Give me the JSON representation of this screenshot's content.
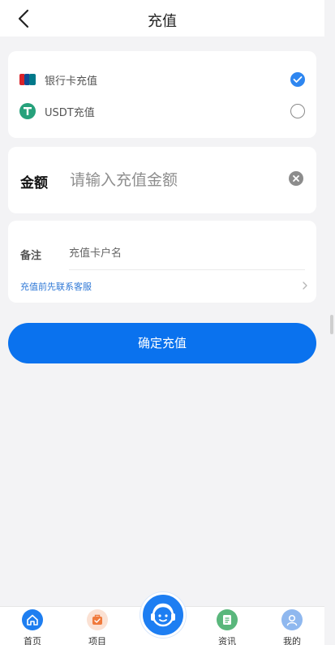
{
  "header": {
    "title": "充值"
  },
  "payment": {
    "methods": [
      {
        "label": "银行卡充值",
        "icon": "unionpay-icon",
        "selected": true
      },
      {
        "label": "USDT充值",
        "icon": "tether-icon",
        "selected": false
      }
    ]
  },
  "amount": {
    "label": "金额",
    "placeholder": "请输入充值金额"
  },
  "remark": {
    "label": "备注",
    "placeholder": "充值卡户名",
    "contact_link": "充值前先联系客服"
  },
  "submit": {
    "label": "确定充值"
  },
  "tabbar": {
    "items": [
      {
        "label": "首页",
        "icon": "home-icon"
      },
      {
        "label": "项目",
        "icon": "project-icon"
      },
      {
        "label": "资讯",
        "icon": "news-icon"
      },
      {
        "label": "我的",
        "icon": "user-icon"
      }
    ],
    "center_icon": "customer-service-icon"
  },
  "colors": {
    "accent": "#0a72ee",
    "radio_checked": "#2e86f0",
    "link": "#2f78d6",
    "background": "#f3f3f5"
  }
}
